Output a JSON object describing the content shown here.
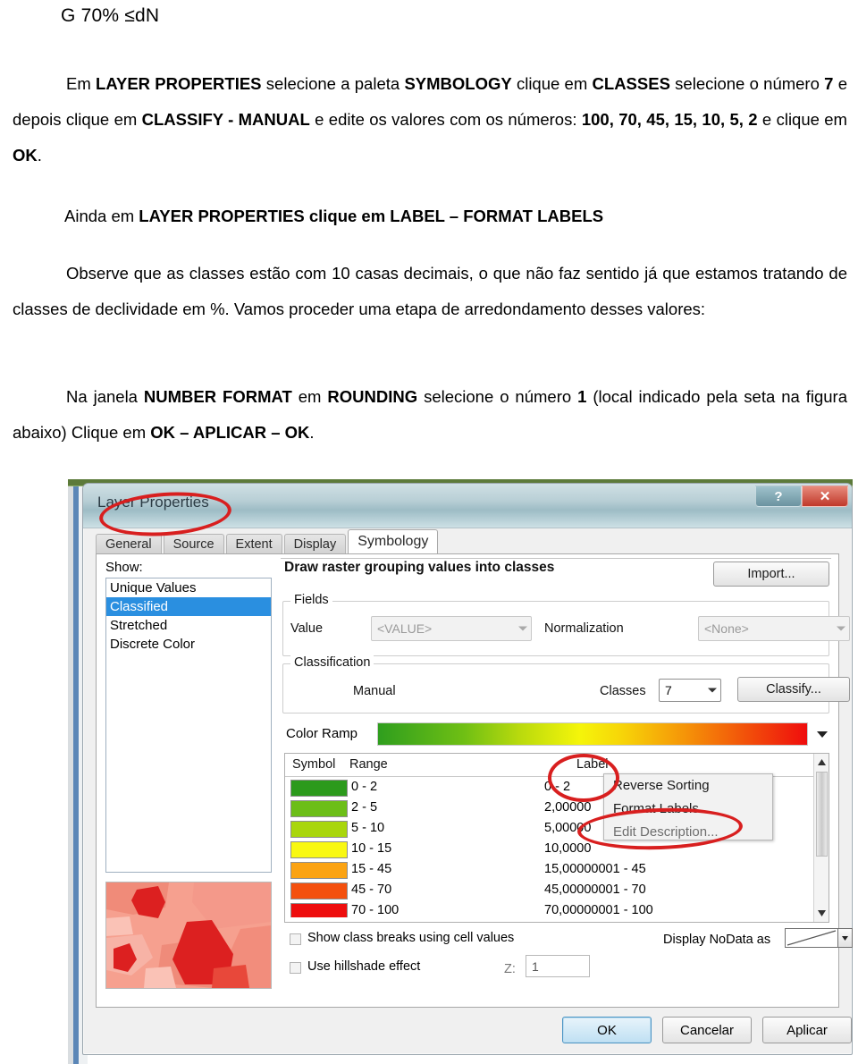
{
  "document": {
    "header": "G 70% ≤dN",
    "paragraphs": [
      {
        "id": "p1",
        "runs": [
          {
            "t": "Em ",
            "b": false
          },
          {
            "t": "LAYER PROPERTIES",
            "b": true
          },
          {
            "t": " selecione a paleta ",
            "b": false
          },
          {
            "t": "SYMBOLOGY",
            "b": true
          },
          {
            "t": " clique em ",
            "b": false
          },
          {
            "t": "CLASSES",
            "b": true
          },
          {
            "t": " selecione o número ",
            "b": false
          },
          {
            "t": "7",
            "b": true
          },
          {
            "t": " e depois clique em ",
            "b": false
          },
          {
            "t": "CLASSIFY - MANUAL",
            "b": true
          },
          {
            "t": " e edite os valores com os números: ",
            "b": false
          },
          {
            "t": "100, 70, 45, 15, 10, 5, 2",
            "b": true
          },
          {
            "t": " e clique em ",
            "b": false
          },
          {
            "t": "OK",
            "b": true
          },
          {
            "t": ".",
            "b": false
          }
        ]
      },
      {
        "id": "p2",
        "runs": [
          {
            "t": "Ainda em ",
            "b": false
          },
          {
            "t": "LAYER PROPERTIES clique em LABEL – FORMAT LABELS",
            "b": true
          }
        ]
      },
      {
        "id": "p3",
        "runs": [
          {
            "t": "Observe que as classes estão com 10 casas decimais, o que não faz sentido já que estamos tratando de classes de declividade em %. Vamos proceder uma etapa de arredondamento desses valores:",
            "b": false
          }
        ]
      },
      {
        "id": "p4",
        "runs": [
          {
            "t": "Na janela ",
            "b": false
          },
          {
            "t": "NUMBER FORMAT",
            "b": true
          },
          {
            "t": " em ",
            "b": false
          },
          {
            "t": "ROUNDING",
            "b": true
          },
          {
            "t": " selecione o número ",
            "b": false
          },
          {
            "t": "1",
            "b": true
          },
          {
            "t": " (local indicado pela seta na figura abaixo) Clique em ",
            "b": false
          },
          {
            "t": "OK – APLICAR – OK",
            "b": true
          },
          {
            "t": ".",
            "b": false
          }
        ]
      }
    ]
  },
  "dialog": {
    "title": "Layer Properties",
    "help_button": "?",
    "close_button": "✕",
    "tabs": [
      {
        "label": "General",
        "active": false
      },
      {
        "label": "Source",
        "active": false
      },
      {
        "label": "Extent",
        "active": false
      },
      {
        "label": "Display",
        "active": false
      },
      {
        "label": "Symbology",
        "active": true
      }
    ],
    "show_label": "Show:",
    "show_items": [
      {
        "label": "Unique Values",
        "selected": false
      },
      {
        "label": "Classified",
        "selected": true
      },
      {
        "label": "Stretched",
        "selected": false
      },
      {
        "label": "Discrete Color",
        "selected": false
      }
    ],
    "group_header": "Draw raster grouping values into classes",
    "import_button": "Import...",
    "fields_legend": "Fields",
    "value_label": "Value",
    "value_combo": "<VALUE>",
    "normalization_label": "Normalization",
    "normalization_combo": "<None>",
    "classification_legend": "Classification",
    "classification_method": "Manual",
    "classes_label": "Classes",
    "classes_value": "7",
    "classify_button": "Classify...",
    "color_ramp_label": "Color Ramp",
    "table_headers": {
      "symbol": "Symbol",
      "range": "Range",
      "label": "Label"
    },
    "classes": [
      {
        "color": "#2c9a1c",
        "range": "0 - 2",
        "label": "0 - 2"
      },
      {
        "color": "#6cbe17",
        "range": "2 - 5",
        "label": "2,00000"
      },
      {
        "color": "#a9d60c",
        "range": "5 - 10",
        "label": "5,00000"
      },
      {
        "color": "#f9f812",
        "range": "10 - 15",
        "label": "10,0000"
      },
      {
        "color": "#fba313",
        "range": "15 - 45",
        "label": "15,00000001 - 45"
      },
      {
        "color": "#f4500e",
        "range": "45 - 70",
        "label": "45,00000001 - 70"
      },
      {
        "color": "#ee0d0d",
        "range": "70 - 100",
        "label": "70,00000001 - 100"
      }
    ],
    "context_menu": [
      {
        "label": "Reverse Sorting",
        "dim": false
      },
      {
        "label": "Format Labels...",
        "dim": false
      },
      {
        "label": "Edit Description...",
        "dim": true
      }
    ],
    "show_class_breaks_label": "Show class breaks using cell values",
    "use_hillshade_label": "Use hillshade effect",
    "z_label": "Z:",
    "z_value": "1",
    "display_nodata_label": "Display NoData as",
    "footer_buttons": [
      {
        "label": "OK",
        "primary": true
      },
      {
        "label": "Cancelar",
        "primary": false
      },
      {
        "label": "Aplicar",
        "primary": false
      }
    ]
  },
  "colors": {
    "annotation_red": "#d81f1f",
    "selection_blue": "#2a8fe0",
    "titlebar_teal": "#9dbcc5",
    "close_red": "#c0392b"
  }
}
